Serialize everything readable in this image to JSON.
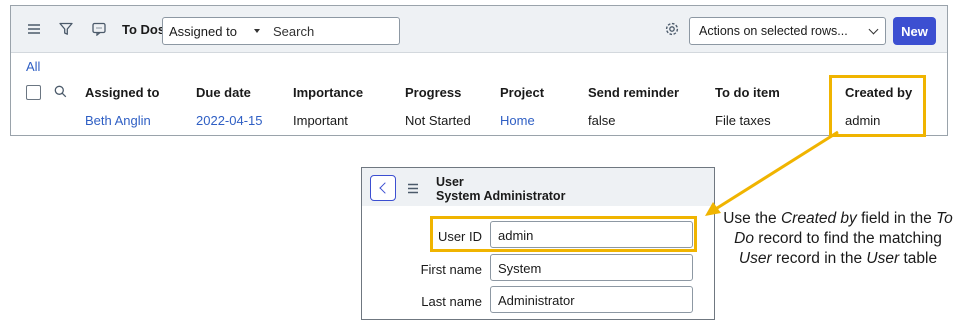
{
  "list": {
    "title": "To Dos",
    "filter_field": "Assigned to",
    "search_placeholder": "Search",
    "actions_label": "Actions on selected rows...",
    "new_label": "New",
    "breadcrumb": "All",
    "columns": [
      "Assigned to",
      "Due date",
      "Importance",
      "Progress",
      "Project",
      "Send reminder",
      "To do item",
      "Created by"
    ],
    "rows": [
      [
        "Beth Anglin",
        "2022-04-15",
        "Important",
        "Not Started",
        "Home",
        "false",
        "File taxes",
        "admin"
      ]
    ]
  },
  "user_form": {
    "header_line1": "User",
    "header_line2": "System Administrator",
    "fields": [
      {
        "label": "User ID",
        "value": "admin"
      },
      {
        "label": "First name",
        "value": "System"
      },
      {
        "label": "Last name",
        "value": "Administrator"
      }
    ]
  },
  "annotation": {
    "p1": "Use the ",
    "em1": "Created by",
    "p2": " field in the ",
    "em2": "To Do",
    "p3": " record to find the matching ",
    "em3": "User",
    "p4": " record in the ",
    "em4": "User",
    "p5": " table"
  },
  "colors": {
    "highlight": "#f0b400",
    "primary_button": "#3c4fd1",
    "link": "#2f5fc4"
  }
}
